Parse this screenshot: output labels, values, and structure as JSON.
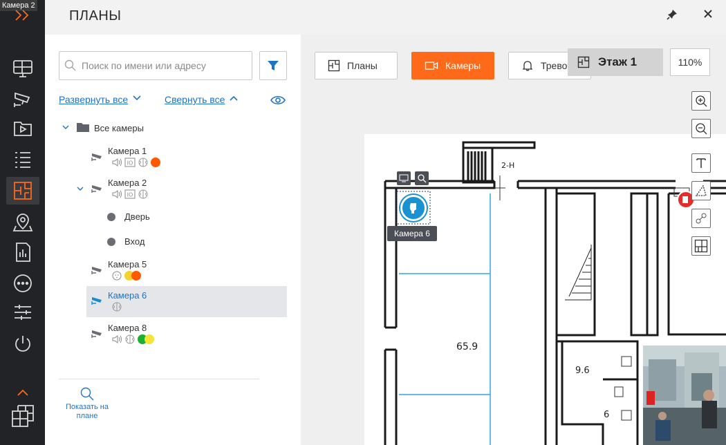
{
  "rail": {
    "window_tag": "Камера 2",
    "items": [
      {
        "icon": "monitor-icon"
      },
      {
        "icon": "cctv-icon"
      },
      {
        "icon": "video-folder-icon"
      },
      {
        "icon": "list-icon"
      },
      {
        "icon": "plans-icon",
        "active": true
      },
      {
        "icon": "map-pin-icon"
      },
      {
        "icon": "report-icon"
      },
      {
        "icon": "more-icon"
      },
      {
        "icon": "sliders-icon"
      },
      {
        "icon": "power-icon"
      }
    ]
  },
  "header": {
    "title": "ПЛАНЫ"
  },
  "search": {
    "placeholder": "Поиск по имени или адресу",
    "value": ""
  },
  "tree_controls": {
    "expand_all": "Развернуть все",
    "collapse_all": "Свернуть все"
  },
  "tree": {
    "root": "Все камеры",
    "cameras": [
      {
        "name": "Камера 1",
        "badges": [
          "#ff5a00"
        ]
      },
      {
        "name": "Камера 2",
        "badges": [],
        "children": [
          "Дверь",
          "Вход"
        ]
      },
      {
        "name": "Камера 5",
        "badges": [
          "#f5d130",
          "#ff5a00"
        ]
      },
      {
        "name": "Камера 6",
        "badges": [],
        "selected": true
      },
      {
        "name": "Камера 8",
        "badges": [
          "#1bb12e",
          "#f5e53a"
        ]
      }
    ]
  },
  "show_on_plan": {
    "line1": "Показать на",
    "line2": "плане"
  },
  "tabs": [
    {
      "label": "Планы",
      "active": false
    },
    {
      "label": "Камеры",
      "active": true
    },
    {
      "label": "Тревоги",
      "active": false
    }
  ],
  "floor": {
    "label": "Этаж 1"
  },
  "zoom": {
    "value": "110%"
  },
  "plan": {
    "labels": {
      "room_area": "65.9",
      "room_small": "9.6",
      "room_tiny": "6",
      "door": "2-Н"
    },
    "camera_tooltip": "Камера 6"
  },
  "colors": {
    "accent": "#ff6a1a",
    "link": "#1c73c7",
    "rail_bg": "#222326"
  }
}
